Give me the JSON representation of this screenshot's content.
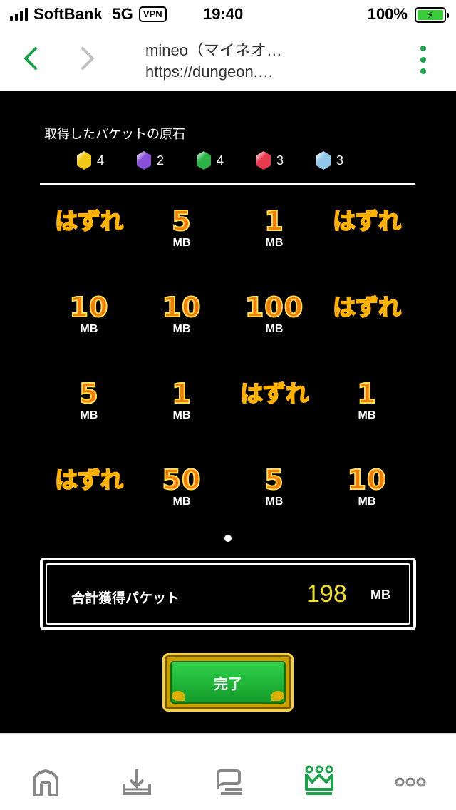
{
  "status_bar": {
    "carrier": "SoftBank",
    "network": "5G",
    "vpn": "VPN",
    "time": "19:40",
    "battery_percent": "100%"
  },
  "browser": {
    "title_line1": "mineo（マイネオ…",
    "title_line2": "https://dungeon.…"
  },
  "stones": {
    "title": "取得したパケットの原石",
    "items": [
      {
        "color": "#f2c718",
        "count": "4"
      },
      {
        "color": "#8a4fd8",
        "count": "2"
      },
      {
        "color": "#2db34a",
        "count": "4"
      },
      {
        "color": "#e8394f",
        "count": "3"
      },
      {
        "color": "#8fc6ea",
        "count": "3"
      }
    ]
  },
  "prizes": [
    {
      "label": "はずれ",
      "unit": ""
    },
    {
      "label": "5",
      "unit": "MB"
    },
    {
      "label": "1",
      "unit": "MB"
    },
    {
      "label": "はずれ",
      "unit": ""
    },
    {
      "label": "10",
      "unit": "MB"
    },
    {
      "label": "10",
      "unit": "MB"
    },
    {
      "label": "100",
      "unit": "MB"
    },
    {
      "label": "はずれ",
      "unit": ""
    },
    {
      "label": "5",
      "unit": "MB"
    },
    {
      "label": "1",
      "unit": "MB"
    },
    {
      "label": "はずれ",
      "unit": ""
    },
    {
      "label": "1",
      "unit": "MB"
    },
    {
      "label": "はずれ",
      "unit": ""
    },
    {
      "label": "50",
      "unit": "MB"
    },
    {
      "label": "5",
      "unit": "MB"
    },
    {
      "label": "10",
      "unit": "MB"
    }
  ],
  "total": {
    "label": "合計獲得パケット",
    "value": "198",
    "unit": "MB"
  },
  "done_button": {
    "label": "完了"
  },
  "tabs": [
    {
      "icon": "home-icon"
    },
    {
      "icon": "share-tray-icon"
    },
    {
      "icon": "layers-icon"
    },
    {
      "icon": "crown-icon",
      "active": true
    },
    {
      "icon": "more-icon"
    }
  ]
}
